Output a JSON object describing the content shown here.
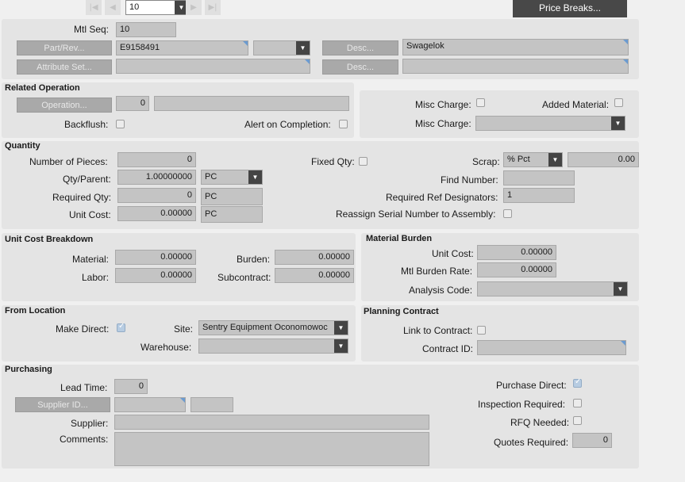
{
  "toolbar": {
    "seq_value": "10",
    "price_breaks_label": "Price Breaks..."
  },
  "header": {
    "mtl_seq_label": "Mtl Seq:",
    "mtl_seq_value": "10",
    "part_rev_button": "Part/Rev...",
    "part_value": "E9158491",
    "rev_value": "",
    "desc_button": "Desc...",
    "desc_value": "Swagelok",
    "attribute_set_button": "Attribute Set...",
    "attribute_set_value": "",
    "desc2_button": "Desc...",
    "desc2_value": ""
  },
  "related_operation": {
    "title": "Related Operation",
    "operation_button": "Operation...",
    "operation_value": "0",
    "operation_desc": "",
    "backflush_label": "Backflush:",
    "backflush_checked": false,
    "alert_label": "Alert on Completion:",
    "alert_checked": false
  },
  "misc": {
    "misc_charge_label": "Misc Charge:",
    "misc_charge_checked": false,
    "added_material_label": "Added Material:",
    "added_material_checked": false,
    "misc_charge2_label": "Misc Charge:",
    "misc_charge2_value": ""
  },
  "quantity": {
    "title": "Quantity",
    "num_pieces_label": "Number of Pieces:",
    "num_pieces_value": "0",
    "qty_parent_label": "Qty/Parent:",
    "qty_parent_value": "1.00000000",
    "qty_parent_uom": "PC",
    "required_qty_label": "Required Qty:",
    "required_qty_value": "0",
    "required_qty_uom": "PC",
    "unit_cost_label": "Unit Cost:",
    "unit_cost_value": "0.00000",
    "unit_cost_uom": "PC",
    "fixed_qty_label": "Fixed Qty:",
    "fixed_qty_checked": false,
    "scrap_label": "Scrap:",
    "scrap_type": "% Pct",
    "scrap_value": "0.00",
    "find_number_label": "Find Number:",
    "find_number_value": "",
    "req_ref_label": "Required Ref Designators:",
    "req_ref_value": "1",
    "reassign_label": "Reassign Serial Number to Assembly:",
    "reassign_checked": false
  },
  "unit_cost_breakdown": {
    "title": "Unit Cost Breakdown",
    "material_label": "Material:",
    "material_value": "0.00000",
    "labor_label": "Labor:",
    "labor_value": "0.00000",
    "burden_label": "Burden:",
    "burden_value": "0.00000",
    "subcontract_label": "Subcontract:",
    "subcontract_value": "0.00000"
  },
  "material_burden": {
    "title": "Material Burden",
    "unit_cost_label": "Unit Cost:",
    "unit_cost_value": "0.00000",
    "burden_rate_label": "Mtl  Burden Rate:",
    "burden_rate_value": "0.00000",
    "analysis_code_label": "Analysis Code:",
    "analysis_code_value": ""
  },
  "from_location": {
    "title": "From Location",
    "make_direct_label": "Make Direct:",
    "make_direct_checked": true,
    "site_label": "Site:",
    "site_value": "Sentry Equipment Oconomowoc",
    "warehouse_label": "Warehouse:",
    "warehouse_value": ""
  },
  "planning_contract": {
    "title": "Planning Contract",
    "link_label": "Link to Contract:",
    "link_checked": false,
    "contract_id_label": "Contract ID:",
    "contract_id_value": ""
  },
  "purchasing": {
    "title": "Purchasing",
    "lead_time_label": "Lead Time:",
    "lead_time_value": "0",
    "supplier_id_button": "Supplier ID...",
    "supplier_id_value": "",
    "supplier_extra_value": "",
    "supplier_label": "Supplier:",
    "supplier_value": "",
    "comments_label": "Comments:",
    "comments_value": "",
    "purchase_direct_label": "Purchase Direct:",
    "purchase_direct_checked": true,
    "inspection_label": "Inspection  Required:",
    "inspection_checked": false,
    "rfq_label": "RFQ Needed:",
    "rfq_checked": false,
    "quotes_label": "Quotes Required:",
    "quotes_value": "0"
  }
}
